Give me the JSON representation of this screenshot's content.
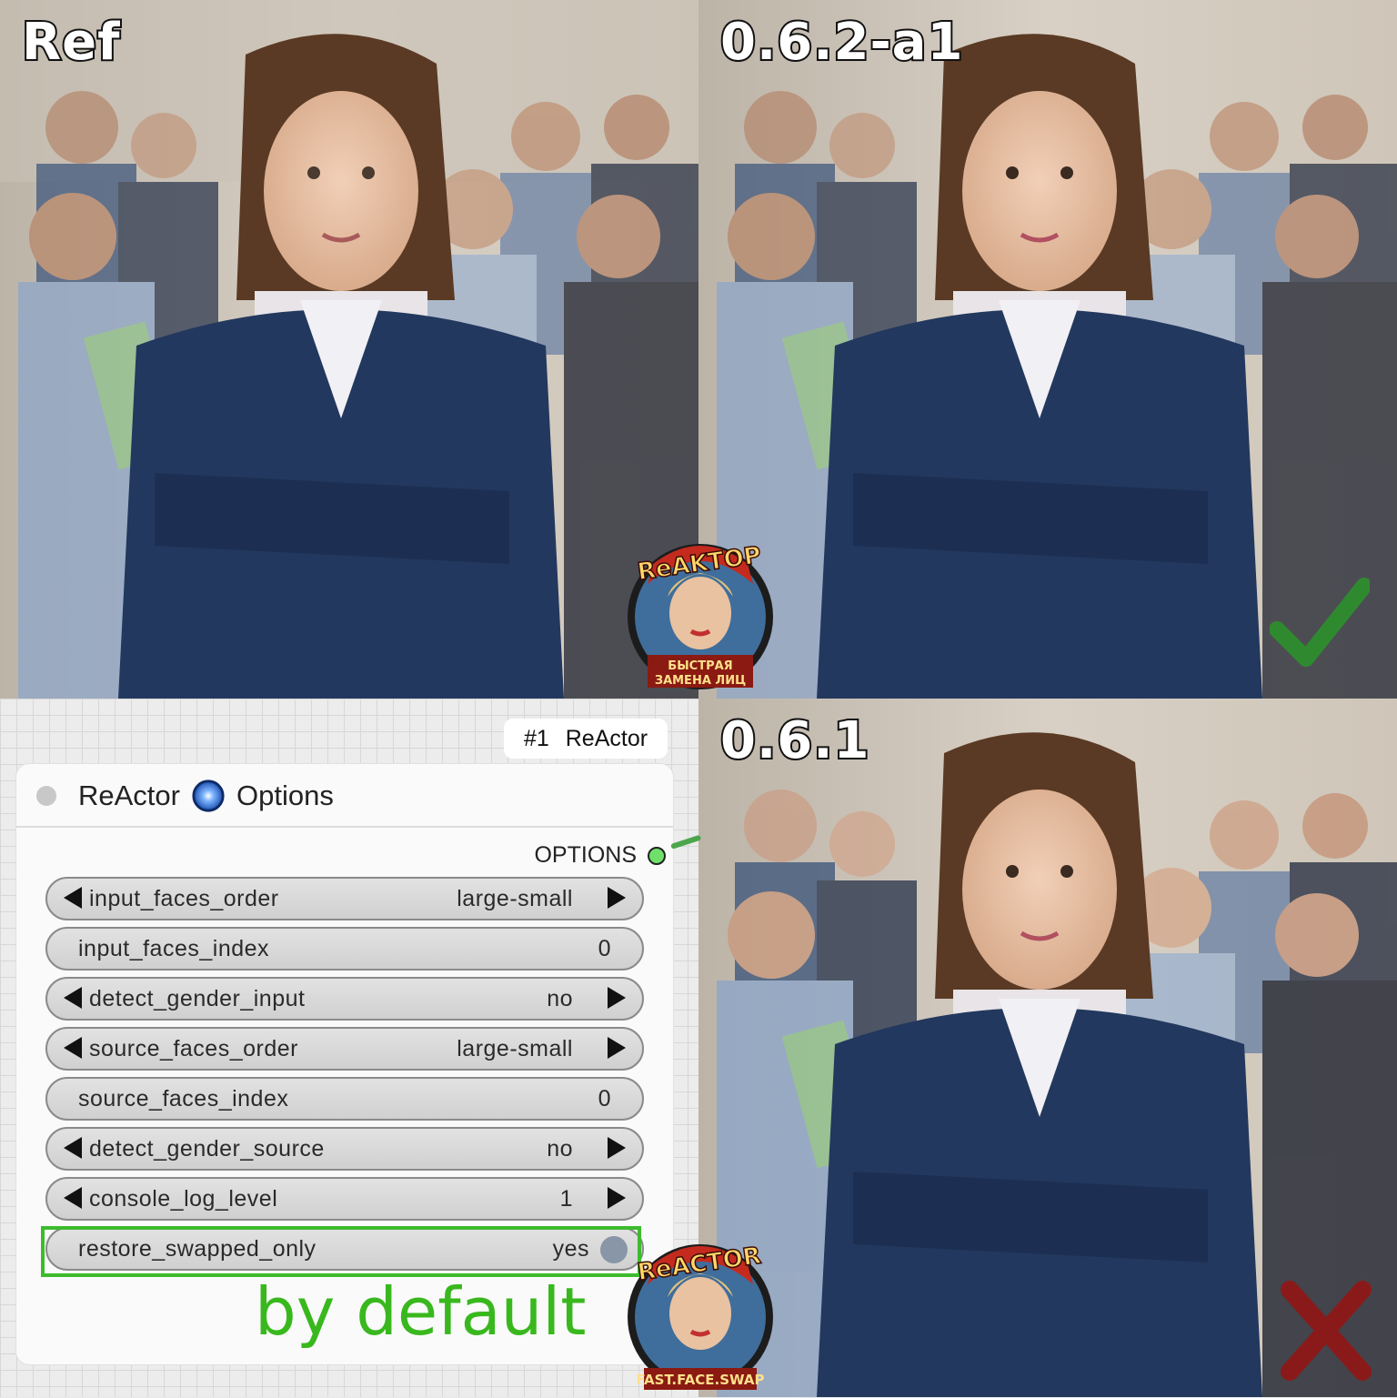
{
  "labels": {
    "ref": "Ref",
    "a1": "0.6.2-a1",
    "v061": "0.6.1"
  },
  "node": {
    "badge_id": "#1",
    "badge_name": "ReActor",
    "title_left": "ReActor",
    "title_right": "Options",
    "output_label": "OPTIONS",
    "widgets": [
      {
        "label": "input_faces_order",
        "value": "large-small"
      },
      {
        "label": "input_faces_index",
        "value": "0"
      },
      {
        "label": "detect_gender_input",
        "value": "no"
      },
      {
        "label": "source_faces_order",
        "value": "large-small"
      },
      {
        "label": "source_faces_index",
        "value": "0"
      },
      {
        "label": "detect_gender_source",
        "value": "no"
      },
      {
        "label": "console_log_level",
        "value": "1"
      },
      {
        "label": "restore_swapped_only",
        "value": "yes"
      }
    ]
  },
  "annotation": {
    "by_default": "by default"
  },
  "logos": {
    "top_brand": "ReAKTOP",
    "top_caption_1": "БЫСТРАЯ",
    "top_caption_2": "ЗАМЕНА ЛИЦ",
    "bottom_brand": "ReACTOR",
    "bottom_caption": "FAST.FACE.SWAP"
  },
  "marks": {
    "check_icon": "checkmark-icon",
    "cross_icon": "cross-icon",
    "check_color": "#2f8a2f",
    "cross_color": "#8a1a1a"
  }
}
